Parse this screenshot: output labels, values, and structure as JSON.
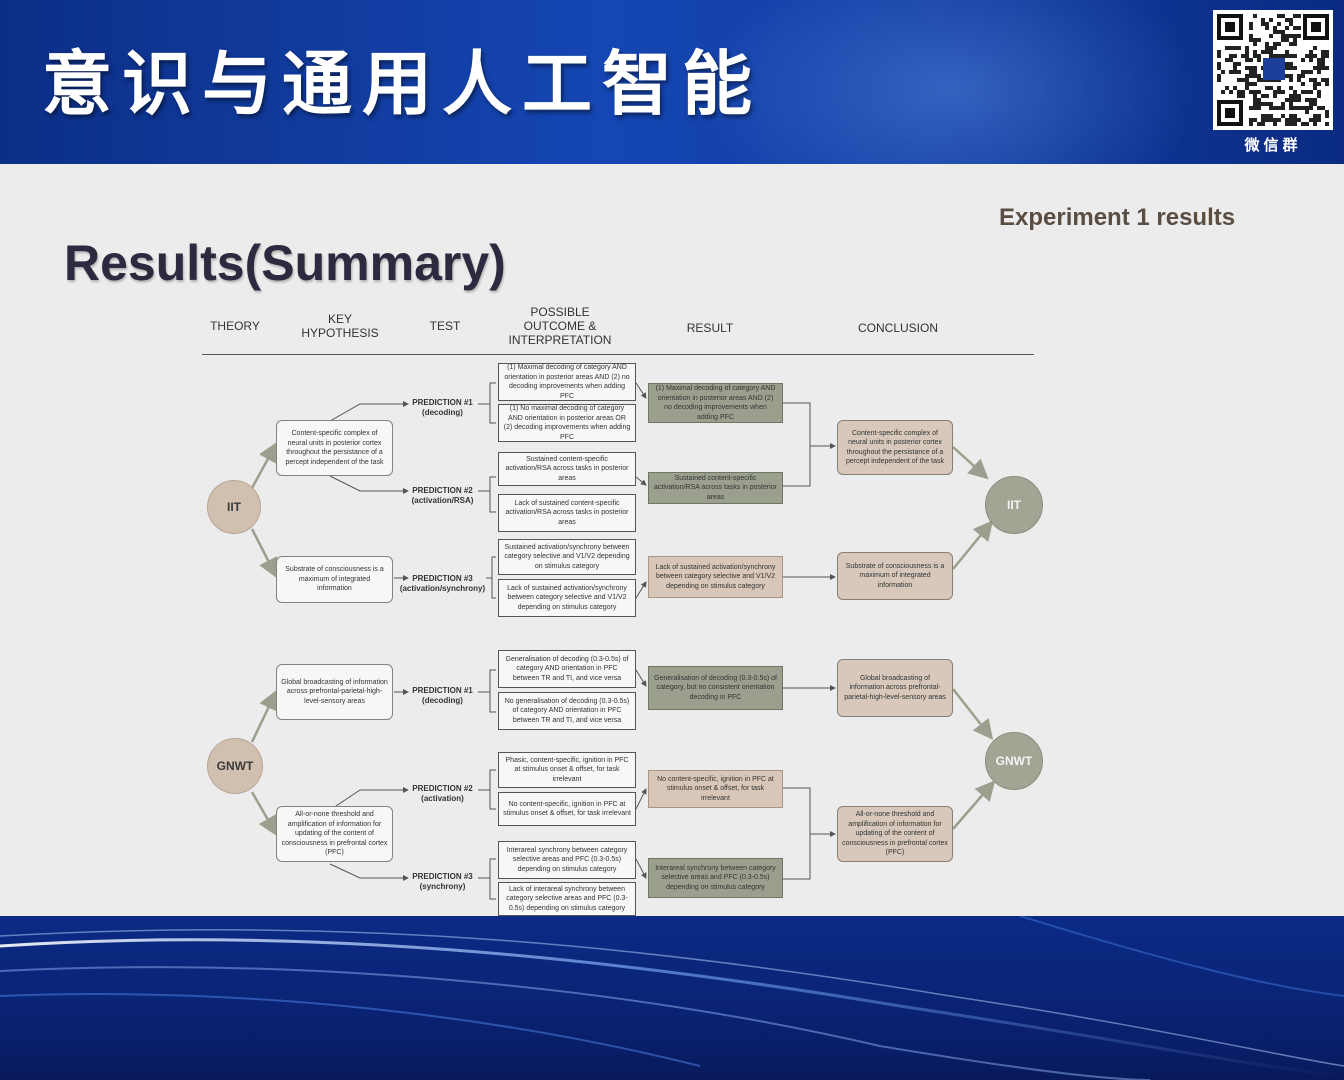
{
  "header": {
    "title": "意识与通用人工智能",
    "qr_caption": "微信群",
    "colors": {
      "band": "#1546b3",
      "title_text": "#ffffff"
    }
  },
  "slide": {
    "experiment_label": "Experiment 1 results",
    "title": "Results(Summary)",
    "columns": {
      "theory": "THEORY",
      "hypothesis": [
        "KEY",
        "HYPOTHESIS"
      ],
      "test": "TEST",
      "outcome": [
        "POSSIBLE",
        "OUTCOME &",
        "INTERPRETATION"
      ],
      "result": "RESULT",
      "conclusion": "CONCLUSION"
    },
    "iit": {
      "theory_label": "IIT",
      "conclusion_label": "IIT",
      "hypotheses": [
        "Content-specific complex of neural units in posterior cortex throughout the persistance of a percept independent of the task",
        "Substrate of consciousness is a maximum of integrated information"
      ],
      "predictions": [
        {
          "label": "PREDICTION #1",
          "sub": "(decoding)"
        },
        {
          "label": "PREDICTION #2",
          "sub": "(activation/RSA)"
        },
        {
          "label": "PREDICTION #3",
          "sub": "(activation/synchrony)"
        }
      ],
      "outcomes": [
        "(1) Maximal decoding of category AND orientation in posterior areas AND (2) no decoding improvements when adding PFC",
        "(1) No maximal decoding of category AND orientation in posterior areas OR (2) decoding improvements when adding PFC",
        "Sustained content-specific activation/RSA across tasks in posterior areas",
        "Lack of sustained content-specific activation/RSA across tasks in posterior areas",
        "Sustained activation/synchrony between category selective and V1/V2 depending on stimulus category",
        "Lack of sustained activation/synchrony between category selective and V1/V2 depending on stimulus category"
      ],
      "results": [
        "(1) Maximal decoding of category AND orientation in posterior areas AND (2) no decoding improvements when adding PFC",
        "Sustained content-specific activation/RSA across tasks in posterior areas",
        "Lack of sustained activation/synchrony between category selective and V1/V2 depending on stimulus category"
      ],
      "conclusions": [
        "Content-specific complex of neural units in posterior cortex throughout the persistance of a percept independent of the task",
        "Substrate of consciousness is a maximum of integrated information"
      ]
    },
    "gnwt": {
      "theory_label": "GNWT",
      "conclusion_label": "GNWT",
      "hypotheses": [
        "Global broadcasting of information across prefrontal-parietal-high-level-sensory areas",
        "All-or-none threshold and amplification of information for updating of the content of consciousness in prefrontal cortex (PFC)"
      ],
      "predictions": [
        {
          "label": "PREDICTION #1",
          "sub": "(decoding)"
        },
        {
          "label": "PREDICTION #2",
          "sub": "(activation)"
        },
        {
          "label": "PREDICTION #3",
          "sub": "(synchrony)"
        }
      ],
      "outcomes": [
        "Generalisation of decoding (0.3-0.5s) of category AND orientation in PFC between TR and TI, and vice versa",
        "No generalisation of decoding (0.3-0.5s) of category AND orientation in PFC between TR and TI, and vice versa",
        "Phasic, content-specific, ignition in PFC at stimulus onset & offset, for task irrelevant",
        "No content-specific, ignition in PFC at stimulus onset & offset, for task irrelevant",
        "Interareal synchrony between category selective areas and PFC (0.3-0.5s) depending on stimulus category",
        "Lack of interareal synchrony between category selective areas and PFC (0.3-0.5s) depending on stimulus category"
      ],
      "results": [
        "Generalisation of decoding (0.3-0.5s) of category, but no consistent orientation decoding in PFC",
        "No content-specific, ignition in PFC at stimulus onset & offset, for task irrelevant",
        "Interareal synchrony between category selective areas and PFC (0.3-0.5s) depending on stimulus category"
      ],
      "conclusions": [
        "Global broadcasting of information across prefrontal-parietal-high-level-sensory areas",
        "All-or-none threshold and amplification of information for updating of the content of consciousness in prefrontal cortex (PFC)"
      ]
    },
    "colors": {
      "background": "#ececec",
      "result_green": "#9aa08d",
      "result_tan": "#d8c7b8",
      "conclusion": "#d7c8bb",
      "theory_circle": "#d1bfb0",
      "conclusion_circle": "#a2a594"
    }
  }
}
